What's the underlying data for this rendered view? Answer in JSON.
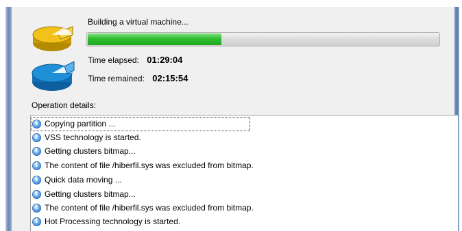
{
  "status": {
    "title": "Building a virtual machine...",
    "progress_percent": 38
  },
  "times": {
    "elapsed_label": "Time elapsed:",
    "elapsed_value": "01:29:04",
    "remained_label": "Time remained:",
    "remained_value": "02:15:54"
  },
  "details": {
    "label": "Operation details:",
    "items": [
      "Copying partition ...",
      "VSS technology is started.",
      "Getting clusters bitmap...",
      "The content of file /hiberfil.sys was excluded from bitmap.",
      "Quick data moving ...",
      "Getting clusters bitmap...",
      "The content of file /hiberfil.sys was excluded from bitmap.",
      "Hot Processing technology is started."
    ]
  },
  "icons": {
    "top": "pie-chart-icon",
    "bottom": "disk-chart-icon",
    "log": "info-icon"
  },
  "colors": {
    "progress": "#2fbd2f",
    "pie_yellow": "#f2c21a",
    "pie_blue": "#1f8fd8"
  }
}
